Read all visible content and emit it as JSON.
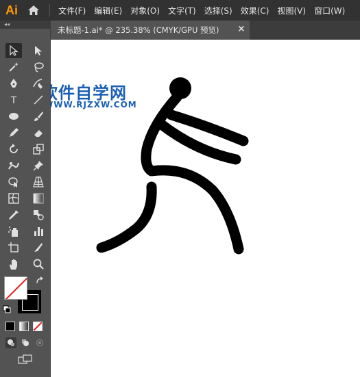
{
  "app": {
    "logo": "Ai"
  },
  "menu": {
    "items": [
      "文件(F)",
      "编辑(E)",
      "对象(O)",
      "文字(T)",
      "选择(S)",
      "效果(C)",
      "视图(V)",
      "窗口(W)"
    ]
  },
  "toolbar": {
    "collapse_glyph": "◂◂"
  },
  "tab": {
    "title": "未标题-1.ai* @ 235.38% (CMYK/GPU 预览)",
    "close_label": "×"
  },
  "tools": {
    "type_tool_glyph": "T"
  },
  "watermark": {
    "title": "软件自学网",
    "url": "WWW.RJZXW.COM"
  },
  "colors": {
    "brand": "#ff9a00",
    "watermark": "#1a5fb4",
    "artwork": "#000000"
  }
}
